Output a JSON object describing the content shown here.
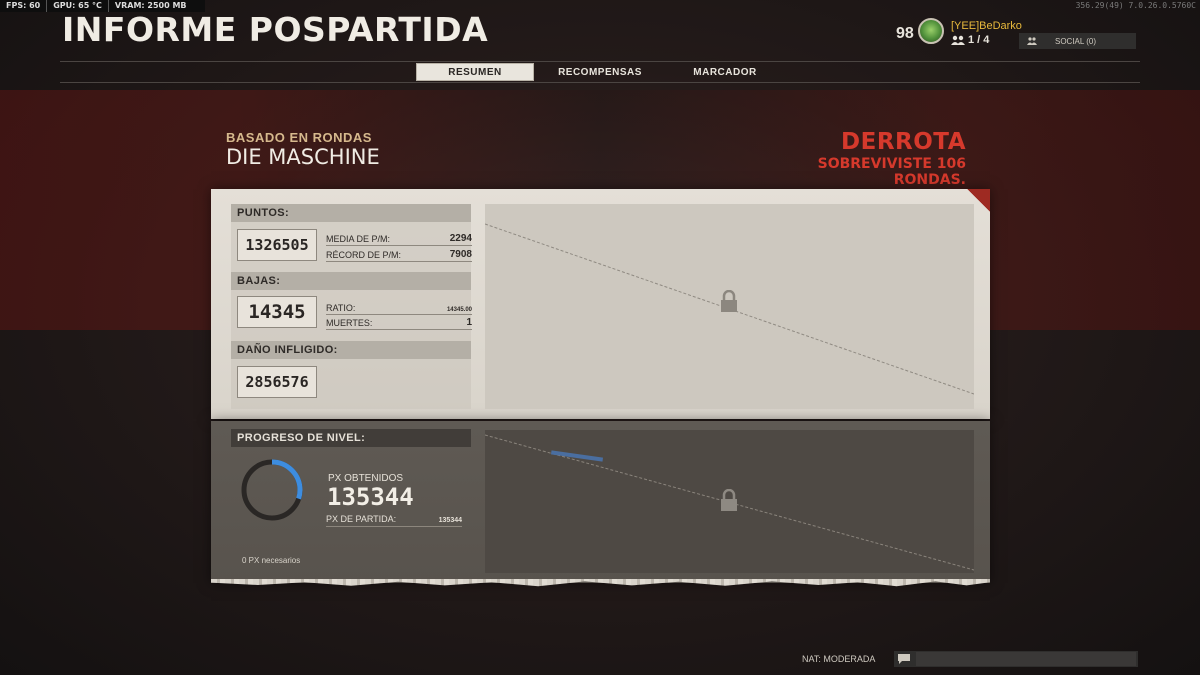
{
  "perf": {
    "fps": "FPS: 60",
    "gpu": "GPU: 65 °C",
    "vram": "VRAM: 2500 MB"
  },
  "build": "356.29(49) 7.0.26.0.5760C",
  "page_title": "INFORME POSPARTIDA",
  "player": {
    "level": "98",
    "name": "[YEE]BeDarko",
    "party": "1 / 4",
    "social": "SOCIAL (0)"
  },
  "tabs": [
    {
      "label": "RESUMEN",
      "active": true
    },
    {
      "label": "RECOMPENSAS",
      "active": false
    },
    {
      "label": "MARCADOR",
      "active": false
    }
  ],
  "match": {
    "mode": "BASADO EN RONDAS",
    "map": "DIE MASCHINE",
    "result": "DERROTA",
    "result_sub": "SOBREVIVISTE 106 RONDAS."
  },
  "stats": {
    "puntos": {
      "label": "PUNTOS:",
      "value": "1326505",
      "rows": [
        {
          "label": "MEDIA DE P/M:",
          "value": "2294"
        },
        {
          "label": "RÉCORD DE P/M:",
          "value": "7908"
        }
      ]
    },
    "bajas": {
      "label": "BAJAS:",
      "value": "14345",
      "rows": [
        {
          "label": "RATIO:",
          "value": "14345.00"
        },
        {
          "label": "MUERTES:",
          "value": "1"
        }
      ]
    },
    "dano": {
      "label": "DAÑO INFLIGIDO:",
      "value": "2856576"
    }
  },
  "progress": {
    "label": "PROGRESO DE NIVEL:",
    "xp_label": "PX OBTENIDOS",
    "xp_value": "135344",
    "match_xp_label": "PX DE PARTIDA:",
    "match_xp_value": "135344",
    "needed": "0 PX necesarios",
    "ring_fraction": 0.3
  },
  "nat": "NAT: MODERADA",
  "colors": {
    "result": "#d6392c",
    "accent_name": "#e7b93c",
    "ring": "#3d8de0"
  }
}
